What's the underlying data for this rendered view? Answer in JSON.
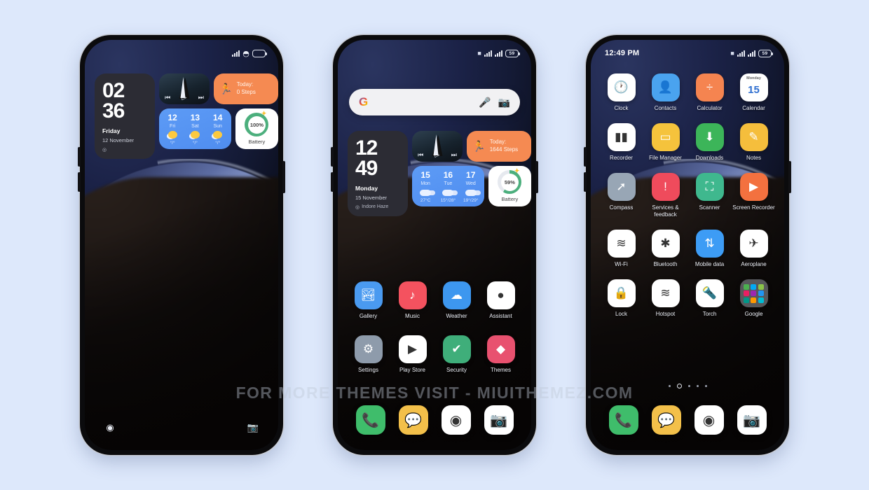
{
  "page": {
    "background_color": "#dde8fb",
    "watermark": "FOR MORE THEMES VISIT - MIUITHEMEZ.COM"
  },
  "phone1": {
    "name": "lock-screen",
    "statusbar": {
      "time": "",
      "icons": [
        "signal-bars",
        "wifi",
        "battery"
      ]
    },
    "clock_widget": {
      "hours": "02",
      "minutes": "36",
      "day": "Friday",
      "date": "12 November",
      "location": ""
    },
    "music_widget": {
      "prev": "⏮",
      "play": "▷",
      "next": "⏭"
    },
    "steps_widget": {
      "line1": "Today:",
      "line2": "0 Steps",
      "color": "#f58a52"
    },
    "weather_widget": {
      "days": [
        {
          "date": "12",
          "name": "Fri",
          "temp": "°/°",
          "icon": "sun-cloud"
        },
        {
          "date": "13",
          "name": "Sat",
          "temp": "°/°",
          "icon": "sun-cloud"
        },
        {
          "date": "14",
          "name": "Sun",
          "temp": "°/°",
          "icon": "sun-cloud"
        }
      ]
    },
    "battery_widget": {
      "percent": "100%",
      "label": "Battery",
      "ring_color": "#4caf7d"
    },
    "bottom": {
      "left_icon": "flashlight-icon",
      "right_icon": "camera-icon"
    }
  },
  "phone2": {
    "name": "home-screen",
    "statusbar": {
      "battery_text": "59",
      "icons": [
        "mute",
        "signal-bars",
        "signal-bars",
        "battery"
      ]
    },
    "search": {
      "google_icon": "G",
      "mic_icon": "mic-icon",
      "lens_icon": "lens-icon",
      "placeholder": ""
    },
    "clock_widget": {
      "hours": "12",
      "minutes": "49",
      "day": "Monday",
      "date": "15 November",
      "location": "Indore  Haze"
    },
    "music_widget": {
      "prev": "⏮",
      "play": "▷",
      "next": "⏭"
    },
    "steps_widget": {
      "line1": "Today:",
      "line2": "1644 Steps",
      "color": "#f58a52"
    },
    "weather_widget": {
      "days": [
        {
          "date": "15",
          "name": "Mon",
          "temp": "27°C",
          "icon": "cloudy"
        },
        {
          "date": "16",
          "name": "Tue",
          "temp": "15°/28°",
          "icon": "cloudy"
        },
        {
          "date": "17",
          "name": "Wed",
          "temp": "19°/29°",
          "icon": "cloudy"
        }
      ]
    },
    "battery_widget": {
      "percent": "59%",
      "label": "Battery",
      "ring_color": "#4caf7d"
    },
    "apps": [
      {
        "label": "Gallery",
        "icon": "gallery-icon",
        "glyph": "🏞",
        "bg": "#4a9af0"
      },
      {
        "label": "Music",
        "icon": "music-icon",
        "glyph": "♪",
        "bg": "#f4525f"
      },
      {
        "label": "Weather",
        "icon": "weather-icon",
        "glyph": "☁",
        "bg": "#3d97ef"
      },
      {
        "label": "Assistant",
        "icon": "assistant-icon",
        "glyph": "●",
        "bg": "#ffffff"
      },
      {
        "label": "Settings",
        "icon": "settings-icon",
        "glyph": "⚙",
        "bg": "#8e9bab"
      },
      {
        "label": "Play Store",
        "icon": "play-store-icon",
        "glyph": "▶",
        "bg": "#ffffff"
      },
      {
        "label": "Security",
        "icon": "security-icon",
        "glyph": "✔",
        "bg": "#3fae7a"
      },
      {
        "label": "Themes",
        "icon": "themes-icon",
        "glyph": "◆",
        "bg": "#e8516f"
      }
    ],
    "dock": [
      {
        "label": "Phone",
        "icon": "phone-icon",
        "glyph": "📞",
        "bg": "#3fbd6b"
      },
      {
        "label": "Messages",
        "icon": "messages-icon",
        "glyph": "💬",
        "bg": "#f3c04a"
      },
      {
        "label": "Chrome",
        "icon": "chrome-icon",
        "glyph": "◉",
        "bg": "#ffffff"
      },
      {
        "label": "Camera",
        "icon": "camera-icon",
        "glyph": "📷",
        "bg": "#ffffff"
      }
    ]
  },
  "phone3": {
    "name": "app-drawer",
    "statusbar": {
      "time": "12:49 PM",
      "battery_text": "59",
      "icons": [
        "mute",
        "signal-bars",
        "signal-bars",
        "battery"
      ]
    },
    "apps": [
      {
        "label": "Clock",
        "icon": "clock-icon",
        "glyph": "🕐",
        "bg": "#ffffff"
      },
      {
        "label": "Contacts",
        "icon": "contacts-icon",
        "glyph": "👤",
        "bg": "#4aa3ef"
      },
      {
        "label": "Calculator",
        "icon": "calculator-icon",
        "glyph": "÷",
        "bg": "#f58450"
      },
      {
        "label": "Calendar",
        "icon": "calendar-icon",
        "glyph": "15",
        "bg": "#ffffff",
        "sub": "Monday"
      },
      {
        "label": "Recorder",
        "icon": "recorder-icon",
        "glyph": "▮▮",
        "bg": "#ffffff"
      },
      {
        "label": "File Manager",
        "icon": "file-manager-icon",
        "glyph": "▭",
        "bg": "#f5c33c"
      },
      {
        "label": "Downloads",
        "icon": "downloads-icon",
        "glyph": "⬇",
        "bg": "#3cb559"
      },
      {
        "label": "Notes",
        "icon": "notes-icon",
        "glyph": "✎",
        "bg": "#f5be3c"
      },
      {
        "label": "Compass",
        "icon": "compass-icon",
        "glyph": "➚",
        "bg": "#98a6b5"
      },
      {
        "label": "Services & feedback",
        "icon": "services-feedback-icon",
        "glyph": "!",
        "bg": "#ef4b5c"
      },
      {
        "label": "Scanner",
        "icon": "scanner-icon",
        "glyph": "⛶",
        "bg": "#3fb88e"
      },
      {
        "label": "Screen Recorder",
        "icon": "screen-recorder-icon",
        "glyph": "▶",
        "bg": "#f3713f"
      },
      {
        "label": "Wi-Fi",
        "icon": "wifi-icon",
        "glyph": "≋",
        "bg": "#ffffff"
      },
      {
        "label": "Bluetooth",
        "icon": "bluetooth-icon",
        "glyph": "✱",
        "bg": "#ffffff"
      },
      {
        "label": "Mobile data",
        "icon": "mobile-data-icon",
        "glyph": "⇅",
        "bg": "#3d9cf5"
      },
      {
        "label": "Aeroplane",
        "icon": "aeroplane-icon",
        "glyph": "✈",
        "bg": "#ffffff"
      },
      {
        "label": "Lock",
        "icon": "lock-icon",
        "glyph": "🔒",
        "bg": "#ffffff"
      },
      {
        "label": "Hotspot",
        "icon": "hotspot-icon",
        "glyph": "≋",
        "bg": "#ffffff"
      },
      {
        "label": "Torch",
        "icon": "torch-icon",
        "glyph": "🔦",
        "bg": "#ffffff"
      },
      {
        "label": "Google",
        "icon": "google-folder-icon",
        "glyph": "",
        "bg": "#57585c"
      }
    ],
    "page_dots": {
      "count": 5,
      "active_index": 1
    },
    "dock": [
      {
        "label": "Phone",
        "icon": "phone-icon",
        "glyph": "📞",
        "bg": "#3fbd6b"
      },
      {
        "label": "Messages",
        "icon": "messages-icon",
        "glyph": "💬",
        "bg": "#f3c04a"
      },
      {
        "label": "Chrome",
        "icon": "chrome-icon",
        "glyph": "◉",
        "bg": "#ffffff"
      },
      {
        "label": "Camera",
        "icon": "camera-icon",
        "glyph": "📷",
        "bg": "#ffffff"
      }
    ]
  }
}
